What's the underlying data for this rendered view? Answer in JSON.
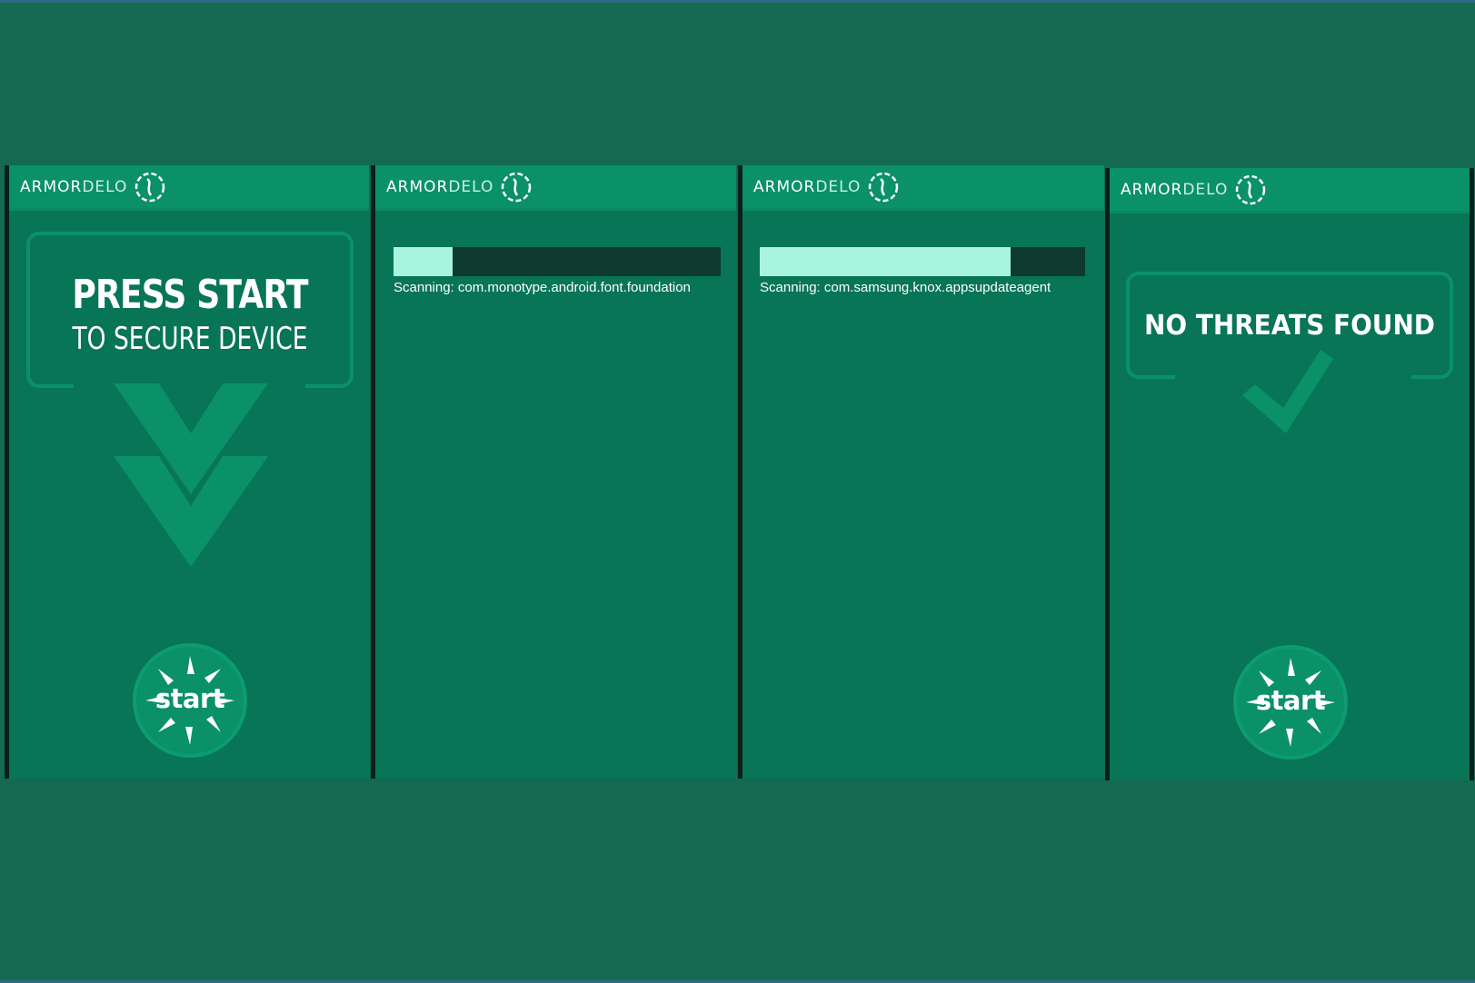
{
  "brand": {
    "logo_part1": "ARMOR",
    "logo_part2": "DELO",
    "logo_icon": "shield-swirl-icon",
    "primary_color": "#087556",
    "appbar_color": "#0a9167",
    "progress_fill_color": "#a8f4dd",
    "progress_track_color": "#0e3b2e"
  },
  "screens": [
    {
      "title": "PRESS START",
      "subtitle": "TO SECURE DEVICE",
      "icon": "double-chevron-down-icon",
      "start_label": "start"
    },
    {
      "progress": 0.18,
      "scan_text": "Scanning: com.monotype.android.font.foundation"
    },
    {
      "progress": 0.77,
      "scan_text": "Scanning: com.samsung.knox.appsupdateagent"
    },
    {
      "result": "NO THREATS FOUND",
      "icon": "checkmark-icon",
      "start_label": "start"
    }
  ]
}
